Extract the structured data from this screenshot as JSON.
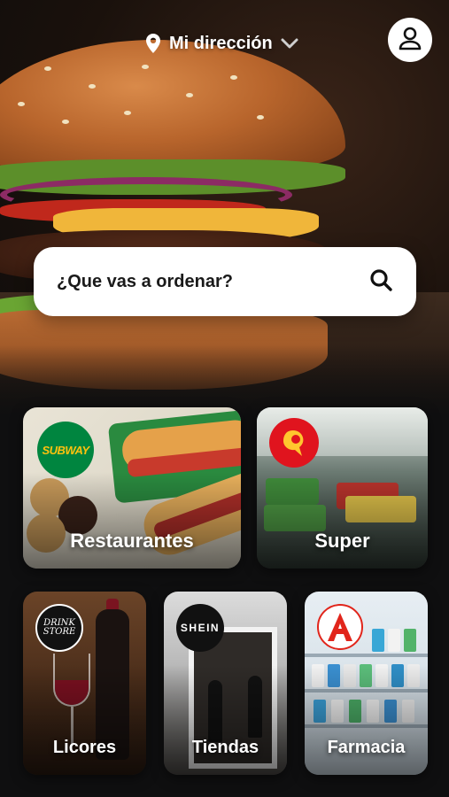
{
  "header": {
    "address_label": "Mi dirección",
    "location_icon": "location-pin-icon",
    "dropdown_icon": "chevron-down-icon",
    "profile_icon": "user-icon"
  },
  "search": {
    "placeholder": "¿Que vas a ordenar?",
    "icon": "search-icon"
  },
  "categories": [
    {
      "label": "Restaurantes",
      "logo": "SUBWAY",
      "logo_color": "#00853f"
    },
    {
      "label": "Super",
      "logo": "super-logo",
      "logo_color": "#e0141e"
    },
    {
      "label": "Licores",
      "logo_lines": [
        "DRINK",
        "STORE"
      ],
      "logo_color": "#121212"
    },
    {
      "label": "Tiendas",
      "logo": "SHEIN",
      "logo_color": "#111111"
    },
    {
      "label": "Farmacia",
      "logo": "pharmacy-a-logo",
      "logo_color": "#e1251b"
    }
  ],
  "colors": {
    "background": "#0f0f10",
    "search_bg": "#ffffff",
    "text": "#ffffff"
  }
}
